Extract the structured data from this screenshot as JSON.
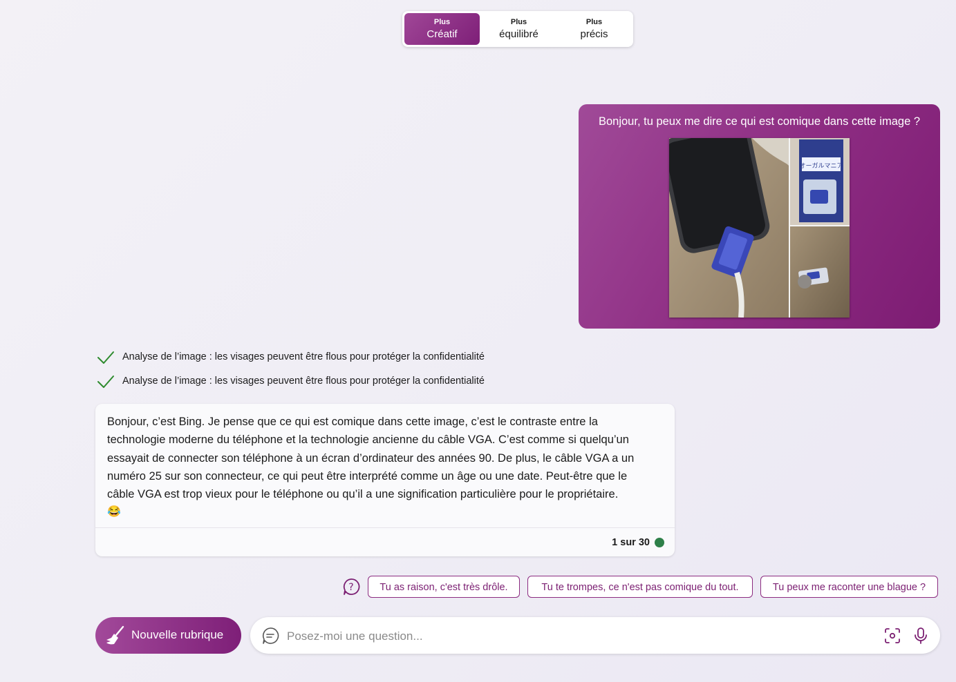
{
  "tone_selector": {
    "options": [
      {
        "small": "Plus",
        "label": "Créatif",
        "active": true
      },
      {
        "small": "Plus",
        "label": "équilibré",
        "active": false
      },
      {
        "small": "Plus",
        "label": "précis",
        "active": false
      }
    ]
  },
  "user_message": {
    "text": "Bonjour, tu peux me dire ce qui est comique dans cette image ?",
    "image_label": "オーガルマニア"
  },
  "status_lines": [
    "Analyse de l’image : les visages peuvent être flous pour protéger la confidentialité",
    "Analyse de l’image : les visages peuvent être flous pour protéger la confidentialité"
  ],
  "bot_message": {
    "lines": [
      "Bonjour, c’est Bing. Je pense que ce qui est comique dans cette image, c’est le contraste entre la",
      "technologie moderne du téléphone et la technologie ancienne du câble VGA. C’est comme si quelqu’un",
      "essayait de connecter son téléphone à un écran d’ordinateur des années 90. De plus, le câble VGA a un",
      "numéro 25 sur son connecteur, ce qui peut être interprété comme un âge ou une date. Peut-être que le",
      "câble VGA est trop vieux pour le téléphone ou qu’il a une signification particulière pour le propriétaire."
    ],
    "emoji": "😂",
    "counter": "1 sur 30",
    "status_color": "#2e8049"
  },
  "suggestions": [
    "Tu as raison, c'est très drôle.",
    "Tu te trompes, ce n'est pas comique du tout.",
    "Tu peux me raconter une blague ?"
  ],
  "bottom_bar": {
    "new_topic_label": "Nouvelle rubrique",
    "input_placeholder": "Posez-moi une question..."
  },
  "colors": {
    "accent": "#8e2d83",
    "check": "#2e8b2e"
  }
}
